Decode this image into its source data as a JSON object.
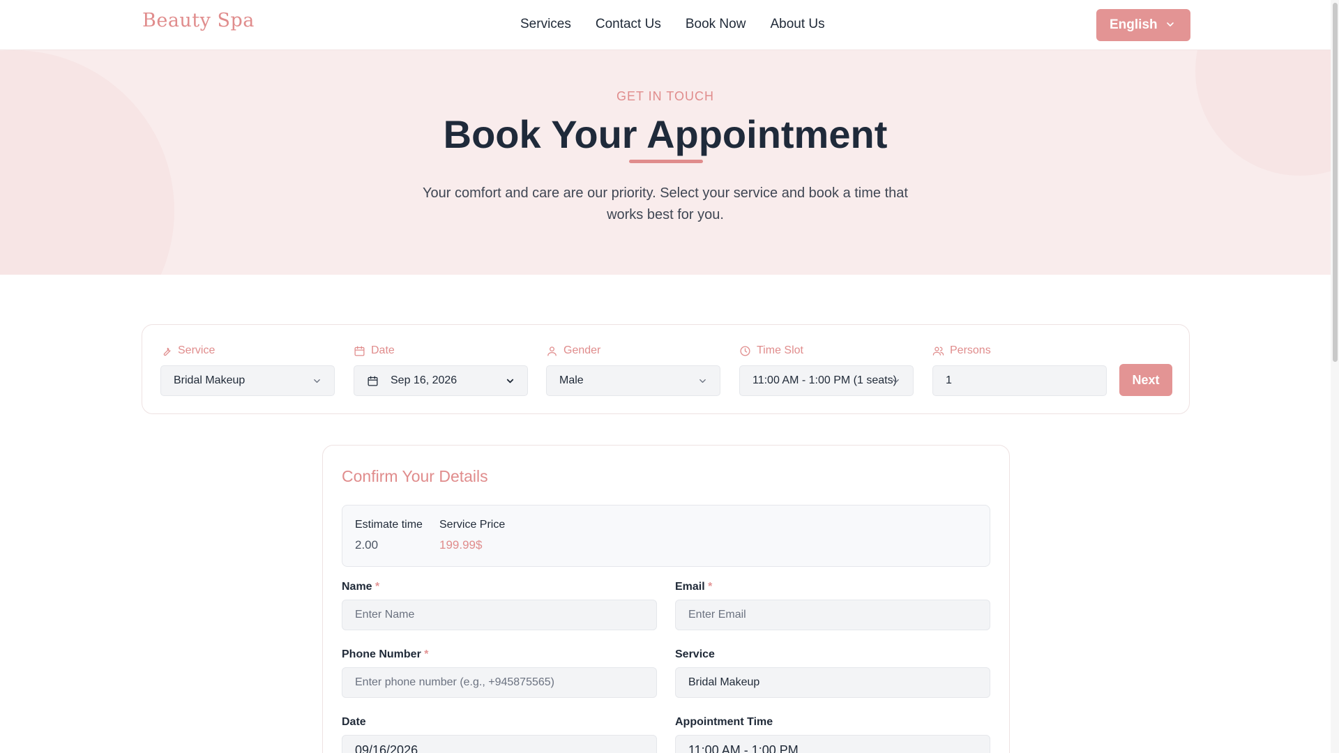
{
  "header": {
    "logo": "Beauty Spa",
    "nav": [
      "Services",
      "Contact Us",
      "Book Now",
      "About Us"
    ],
    "language": "English"
  },
  "hero": {
    "eyebrow": "GET IN TOUCH",
    "title": "Book Your Appointment",
    "subtitle": "Your comfort and care are our priority. Select your service and book a time that works best for you."
  },
  "booking": {
    "service": {
      "label": "Service",
      "value": "Bridal Makeup"
    },
    "date": {
      "label": "Date",
      "value": "Sep 16, 2026"
    },
    "gender": {
      "label": "Gender",
      "value": "Male"
    },
    "time_slot": {
      "label": "Time Slot",
      "value": "11:00 AM - 1:00 PM (1 seats)"
    },
    "persons": {
      "label": "Persons",
      "value": "1"
    },
    "next_label": "Next"
  },
  "details": {
    "title": "Confirm Your Details",
    "estimate_label": "Estimate time",
    "estimate_value": "2.00",
    "price_label": "Service Price",
    "price_value": "199.99$",
    "name": {
      "label": "Name",
      "required": "*",
      "placeholder": "Enter Name"
    },
    "email": {
      "label": "Email",
      "required": "*",
      "placeholder": "Enter Email"
    },
    "phone": {
      "label": "Phone Number",
      "required": "*",
      "placeholder": "Enter phone number (e.g., +945875565)"
    },
    "service": {
      "label": "Service",
      "value": "Bridal Makeup"
    },
    "date": {
      "label": "Date",
      "value": "09/16/2026"
    },
    "appointment_time": {
      "label": "Appointment Time",
      "value": "11:00 AM - 1:00 PM"
    }
  },
  "colors": {
    "accent": "#e39494",
    "hero_bg": "#f9ecec",
    "heading": "#1f2a3a"
  }
}
